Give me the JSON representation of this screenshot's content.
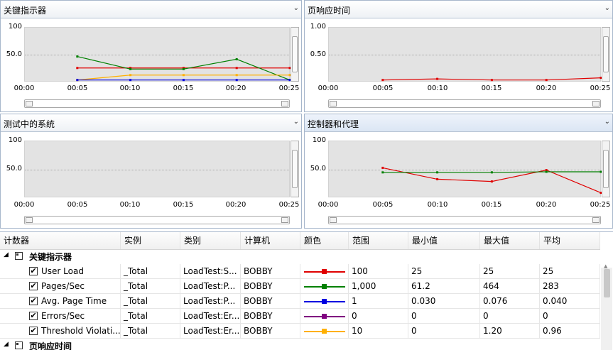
{
  "colors": {
    "red": "#e00000",
    "green": "#008000",
    "blue": "#0000e0",
    "purple": "#800080",
    "orange": "#ffb000"
  },
  "panels": [
    {
      "title": "关键指示器",
      "ylabels": [
        "100",
        "50.0"
      ],
      "xlabels": [
        "00:00",
        "00:05",
        "00:10",
        "00:15",
        "00:20",
        "00:25"
      ],
      "series": [
        {
          "color": "#e00000",
          "points": [
            [
              5,
              25
            ],
            [
              10,
              25
            ],
            [
              15,
              25
            ],
            [
              20,
              25
            ],
            [
              25,
              25
            ]
          ]
        },
        {
          "color": "#008000",
          "points": [
            [
              5,
              46
            ],
            [
              10,
              23
            ],
            [
              15,
              23
            ],
            [
              20,
              41
            ],
            [
              25,
              3
            ]
          ]
        },
        {
          "color": "#ffb000",
          "points": [
            [
              5,
              3
            ],
            [
              10,
              12
            ],
            [
              15,
              12
            ],
            [
              20,
              12
            ],
            [
              25,
              12
            ]
          ]
        },
        {
          "color": "#0000e0",
          "points": [
            [
              5,
              3
            ],
            [
              10,
              3
            ],
            [
              15,
              3
            ],
            [
              20,
              3
            ],
            [
              25,
              3
            ]
          ]
        }
      ]
    },
    {
      "title": "页响应时间",
      "ylabels": [
        "1.00",
        "0.50"
      ],
      "xlabels": [
        "00:00",
        "00:05",
        "00:10",
        "00:15",
        "00:20",
        "00:25"
      ],
      "series": [
        {
          "color": "#e00000",
          "points": [
            [
              5,
              0.03
            ],
            [
              10,
              0.05
            ],
            [
              15,
              0.03
            ],
            [
              20,
              0.03
            ],
            [
              25,
              0.07
            ]
          ]
        }
      ]
    },
    {
      "title": "测试中的系统",
      "ylabels": [
        "100",
        "50.0"
      ],
      "xlabels": [
        "00:00",
        "00:05",
        "00:10",
        "00:15",
        "00:20",
        "00:25"
      ],
      "series": []
    },
    {
      "title": "控制器和代理",
      "ylabels": [
        "100",
        "50.0"
      ],
      "xlabels": [
        "00:00",
        "00:05",
        "00:10",
        "00:15",
        "00:20",
        "00:25"
      ],
      "series": [
        {
          "color": "#e00000",
          "points": [
            [
              5,
              52
            ],
            [
              10,
              32
            ],
            [
              15,
              28
            ],
            [
              20,
              48
            ],
            [
              25,
              8
            ]
          ]
        },
        {
          "color": "#008000",
          "points": [
            [
              5,
              44
            ],
            [
              10,
              44
            ],
            [
              15,
              44
            ],
            [
              20,
              45
            ],
            [
              25,
              45
            ]
          ]
        }
      ]
    }
  ],
  "grid": {
    "headers": [
      "计数器",
      "实例",
      "类别",
      "计算机",
      "颜色",
      "范围",
      "最小值",
      "最大值",
      "平均"
    ],
    "group1": "关键指示器",
    "group2": "页响应时间",
    "rows": [
      {
        "counter": "User Load",
        "instance": "_Total",
        "category": "LoadTest:S...",
        "computer": "BOBBY",
        "color": "#e00000",
        "range": "100",
        "min": "25",
        "max": "25",
        "avg": "25"
      },
      {
        "counter": "Pages/Sec",
        "instance": "_Total",
        "category": "LoadTest:P...",
        "computer": "BOBBY",
        "color": "#008000",
        "range": "1,000",
        "min": "61.2",
        "max": "464",
        "avg": "283"
      },
      {
        "counter": "Avg. Page Time",
        "instance": "_Total",
        "category": "LoadTest:P...",
        "computer": "BOBBY",
        "color": "#0000e0",
        "range": "1",
        "min": "0.030",
        "max": "0.076",
        "avg": "0.040"
      },
      {
        "counter": "Errors/Sec",
        "instance": "_Total",
        "category": "LoadTest:Er...",
        "computer": "BOBBY",
        "color": "#800080",
        "range": "0",
        "min": "0",
        "max": "0",
        "avg": "0"
      },
      {
        "counter": "Threshold Violati...",
        "instance": "_Total",
        "category": "LoadTest:Er...",
        "computer": "BOBBY",
        "color": "#ffb000",
        "range": "10",
        "min": "0",
        "max": "1.20",
        "avg": "0.96"
      }
    ]
  }
}
